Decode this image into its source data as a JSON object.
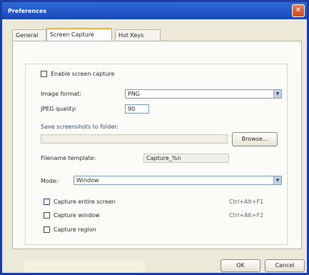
{
  "window": {
    "title": "Preferences",
    "close_glyph": "✕"
  },
  "tabs": [
    {
      "label": "General"
    },
    {
      "label": "Screen Capture"
    },
    {
      "label": "Hot Keys"
    }
  ],
  "capture": {
    "enable_label": "Enable screen capture",
    "format_label": "Image format:",
    "format_value": "PNG",
    "quality_label": "JPEG quality:",
    "quality_value": "90"
  },
  "save": {
    "section_title": "Save screenshots to folder:",
    "folder_value": "",
    "browse_label": "Browse...",
    "filename_label": "Filename template:",
    "filename_value": "Capture_%n"
  },
  "mode": {
    "label": "Mode:",
    "value": "Window"
  },
  "hotkeys": [
    {
      "label": "Capture entire screen",
      "shortcut": "Ctrl+Alt+F1"
    },
    {
      "label": "Capture window",
      "shortcut": "Ctrl+Alt+F2"
    },
    {
      "label": "Capture region",
      "shortcut": ""
    }
  ],
  "buttons": {
    "ok_label": "OK",
    "cancel_label": "Cancel"
  },
  "icons": {
    "close": "close-icon",
    "dropdown": "chevron-down-icon"
  }
}
